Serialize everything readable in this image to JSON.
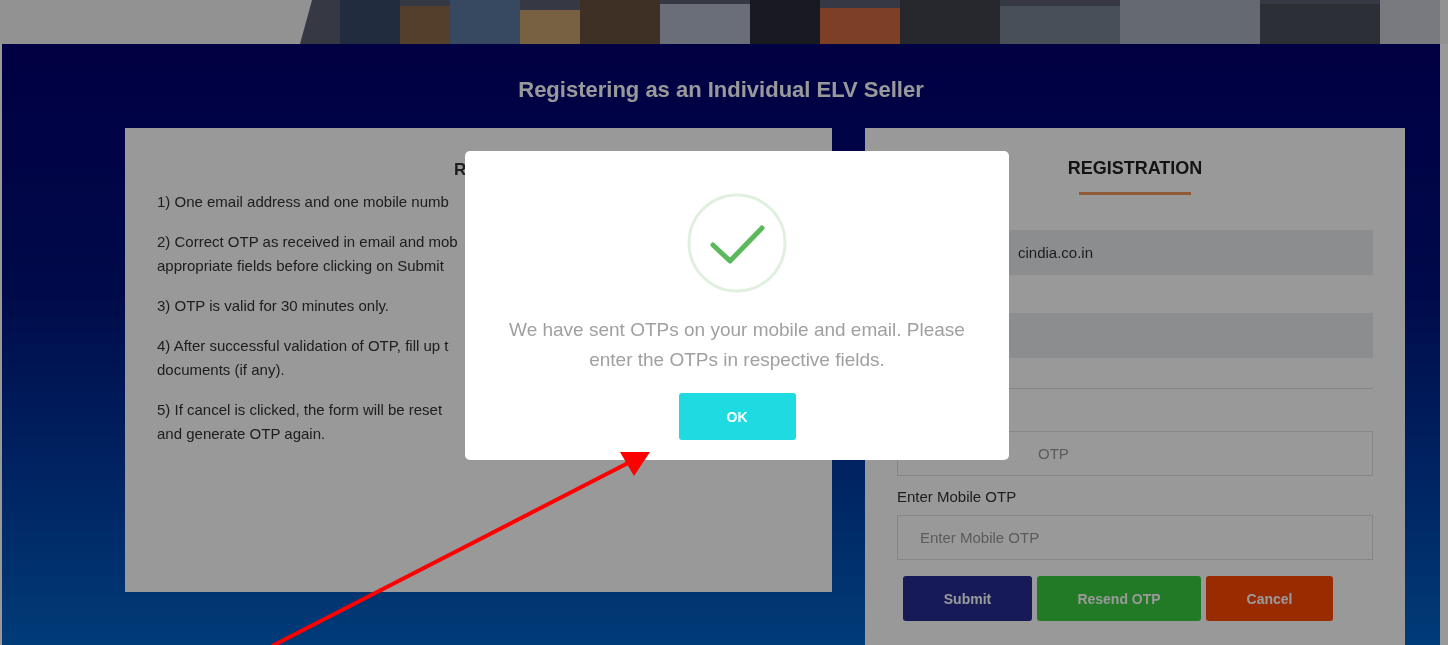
{
  "page_title": "Registering as an Individual ELV Seller",
  "rules": {
    "heading": "R",
    "items": [
      [
        "1) One email address and one mobile numb"
      ],
      [
        "2) Correct OTP as received in email and mob",
        "appropriate fields before clicking on Submit"
      ],
      [
        "3) OTP is valid for 30 minutes only."
      ],
      [
        "4) After successful validation of OTP, fill up t",
        "documents (if any)."
      ],
      [
        "5) If cancel is clicked, the form will be reset",
        "and generate OTP again."
      ]
    ]
  },
  "registration": {
    "heading": "REGISTRATION",
    "fields": [
      {
        "value": "cindia.co.in",
        "disabled": true
      },
      {
        "disabled": true
      },
      {
        "placeholder": "OTP",
        "disabled": false
      },
      {
        "label": "Enter Mobile OTP",
        "placeholder": "Enter Mobile OTP",
        "disabled": false
      }
    ],
    "buttons": [
      {
        "label": "Submit",
        "kind": "primary"
      },
      {
        "label": "Resend OTP",
        "kind": "success"
      },
      {
        "label": "Cancel",
        "kind": "danger"
      }
    ]
  },
  "modal": {
    "message": "We have sent OTPs on your mobile and email. Please enter the OTPs in respective fields.",
    "button": "OK"
  }
}
